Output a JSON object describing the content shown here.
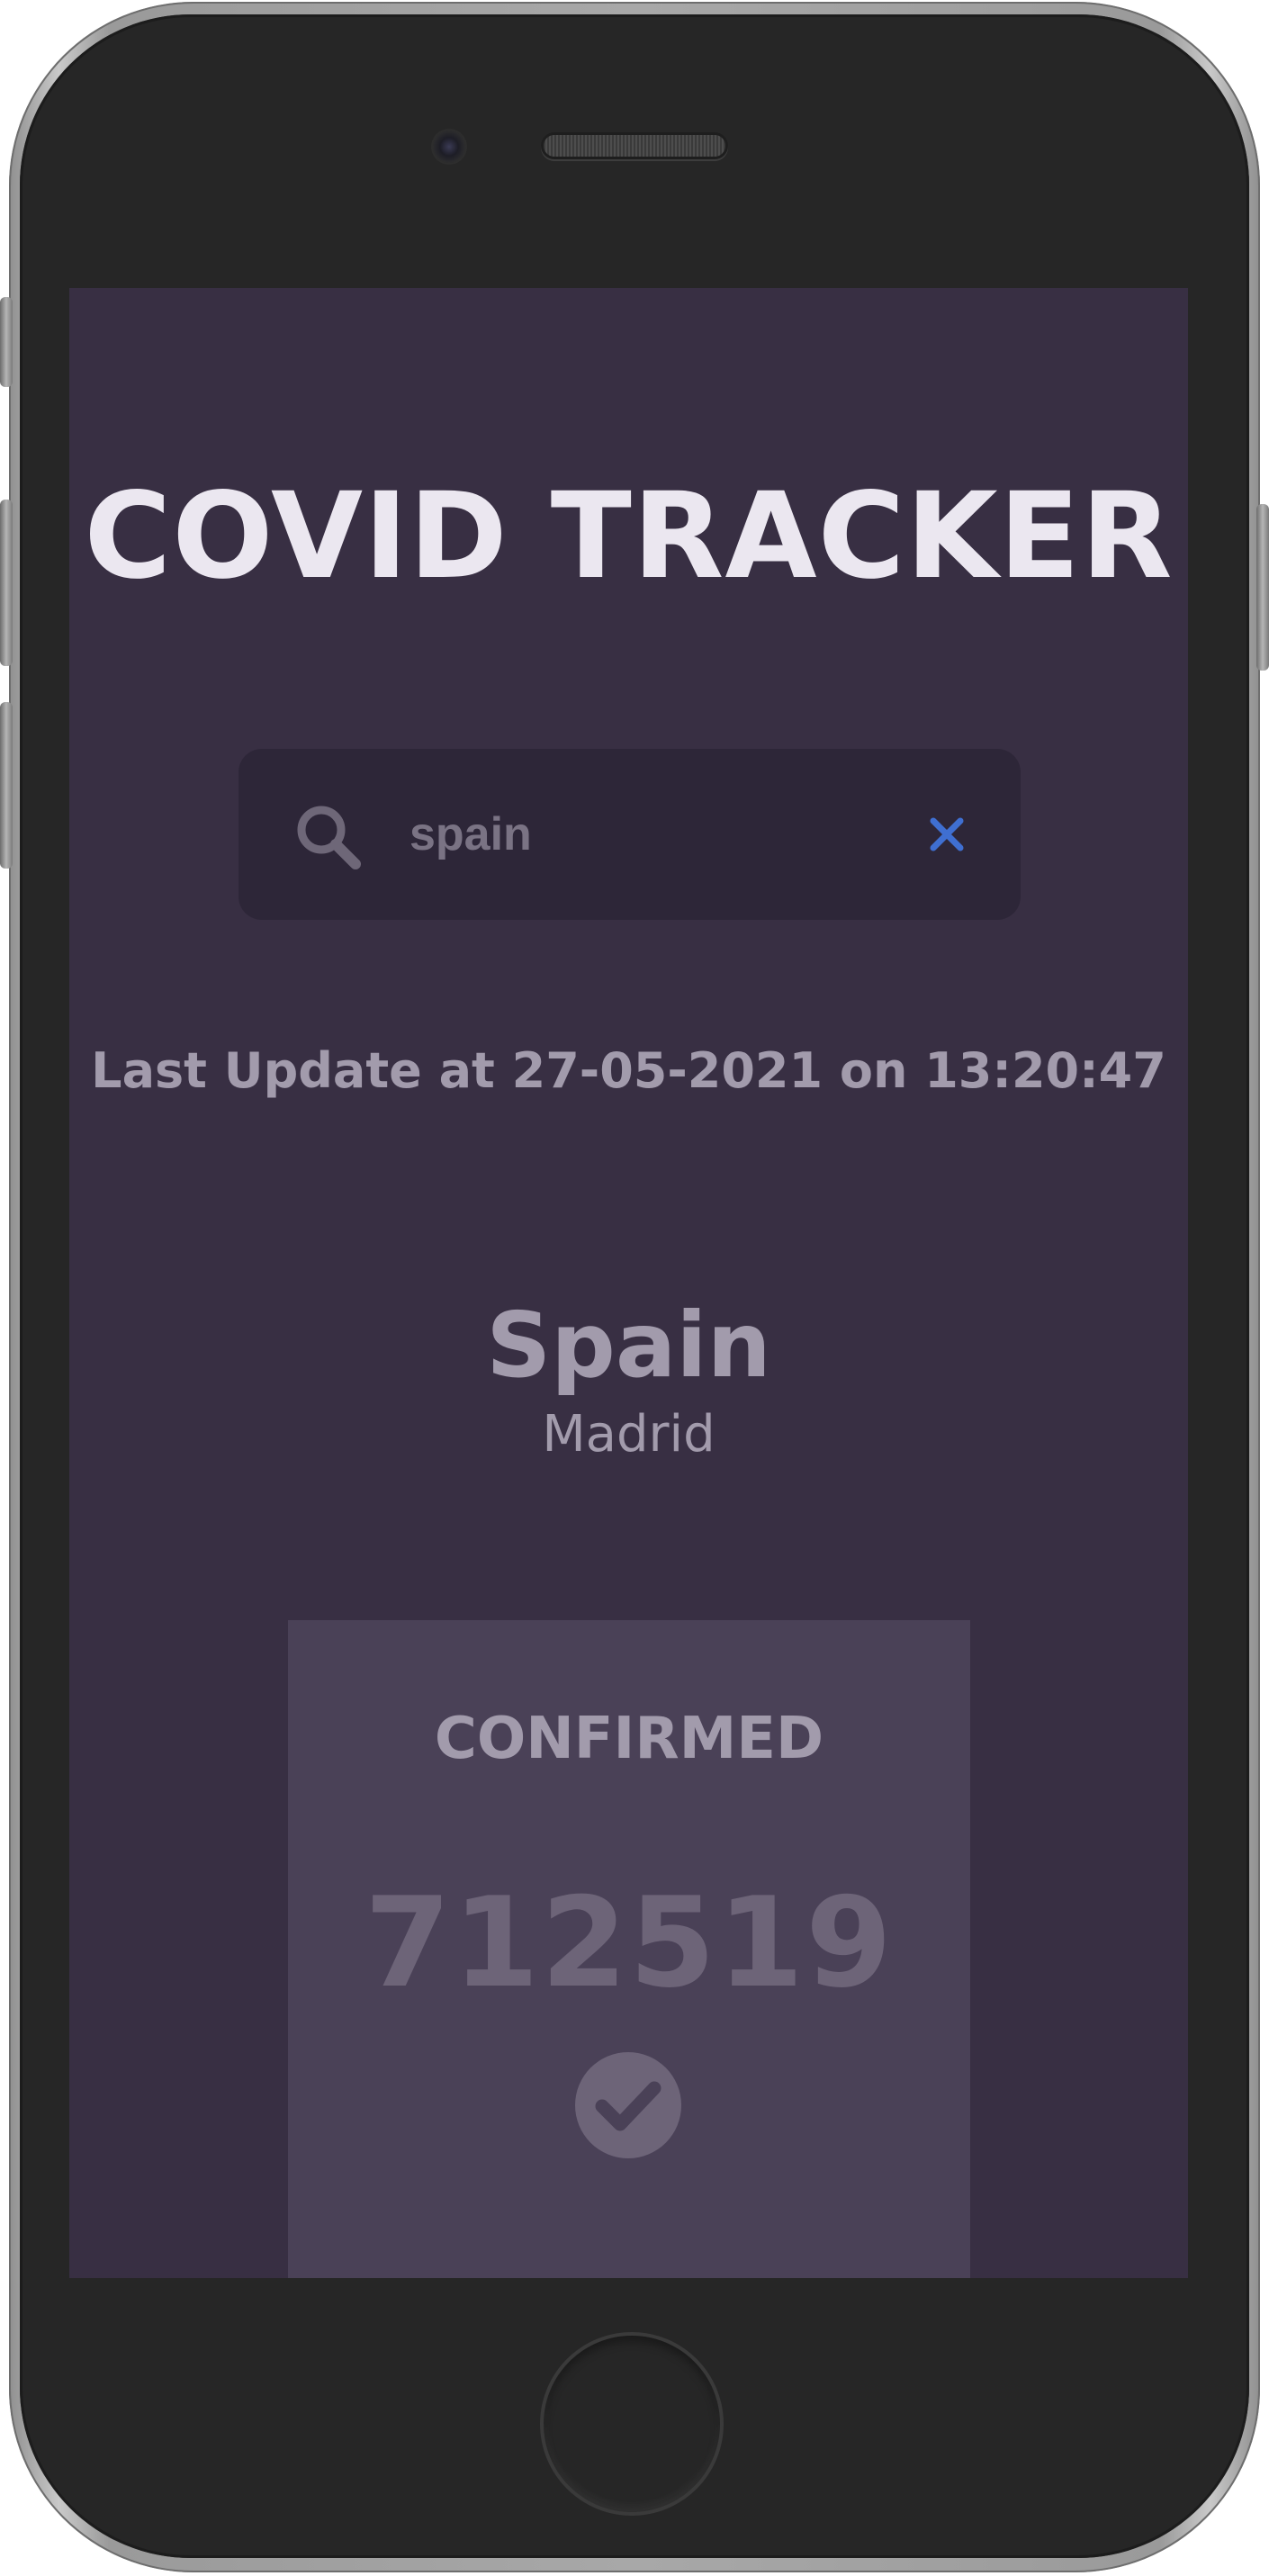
{
  "app": {
    "title": "COVID TRACKER"
  },
  "search": {
    "value": "spain",
    "placeholder": "spain",
    "icon": "search-icon",
    "clear_icon": "close-icon"
  },
  "status": {
    "last_update": "Last Update at 27-05-2021 on 13:20:47"
  },
  "location": {
    "country": "Spain",
    "capital": "Madrid"
  },
  "stats": {
    "confirmed_label": "CONFIRMED",
    "confirmed_value": "712519",
    "confirmed_icon": "check-circle-icon"
  },
  "colors": {
    "screen_bg": "#382f43",
    "search_bg": "#2d2638",
    "card_bg": "#4a4157",
    "title_text": "#ebe7f0",
    "muted_text": "#a29bac",
    "clear_icon": "#3f6fd1"
  }
}
